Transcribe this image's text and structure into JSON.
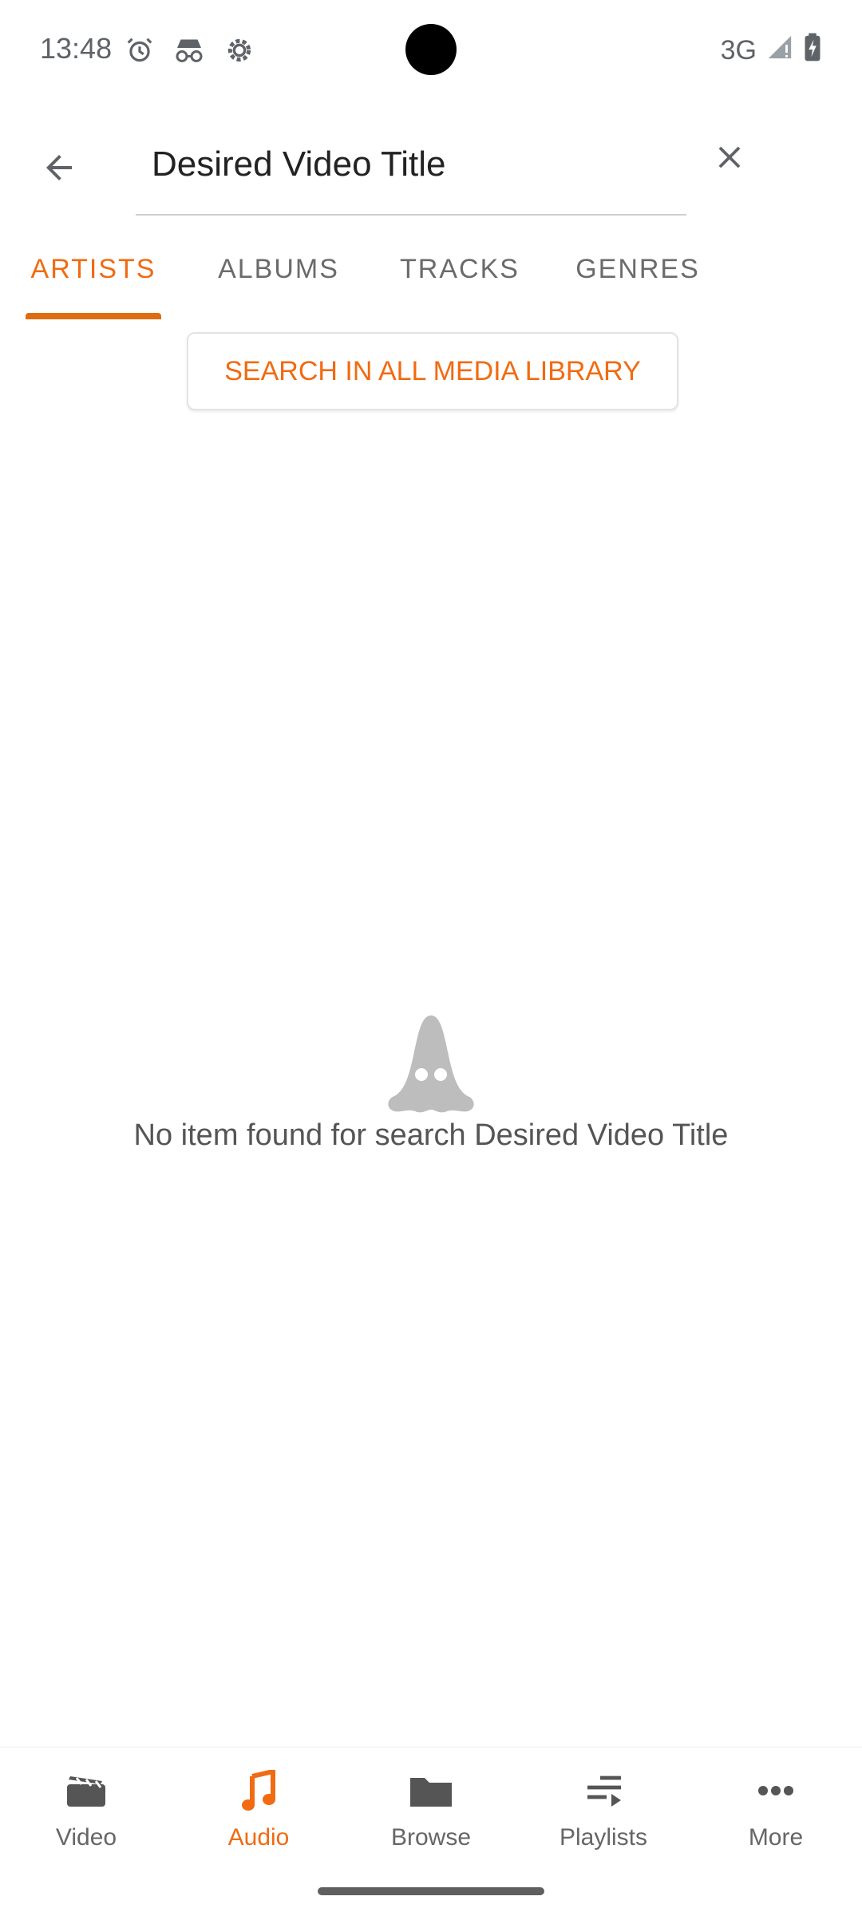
{
  "status": {
    "time": "13:48",
    "network": "3G"
  },
  "search": {
    "value": "Desired Video Title"
  },
  "tabs": [
    {
      "label": "ARTISTS"
    },
    {
      "label": "ALBUMS"
    },
    {
      "label": "TRACKS"
    },
    {
      "label": "GENRES"
    }
  ],
  "search_all": {
    "label": "SEARCH IN ALL MEDIA LIBRARY"
  },
  "empty": {
    "message": "No item found for search Desired Video Title"
  },
  "bottom_nav": [
    {
      "label": "Video",
      "icon": "video-icon"
    },
    {
      "label": "Audio",
      "icon": "music-note-icon"
    },
    {
      "label": "Browse",
      "icon": "folder-icon"
    },
    {
      "label": "Playlists",
      "icon": "playlist-icon"
    },
    {
      "label": "More",
      "icon": "more-horizontal-icon"
    }
  ],
  "colors": {
    "accent": "#f26a12",
    "indicator": "#e06b10"
  }
}
